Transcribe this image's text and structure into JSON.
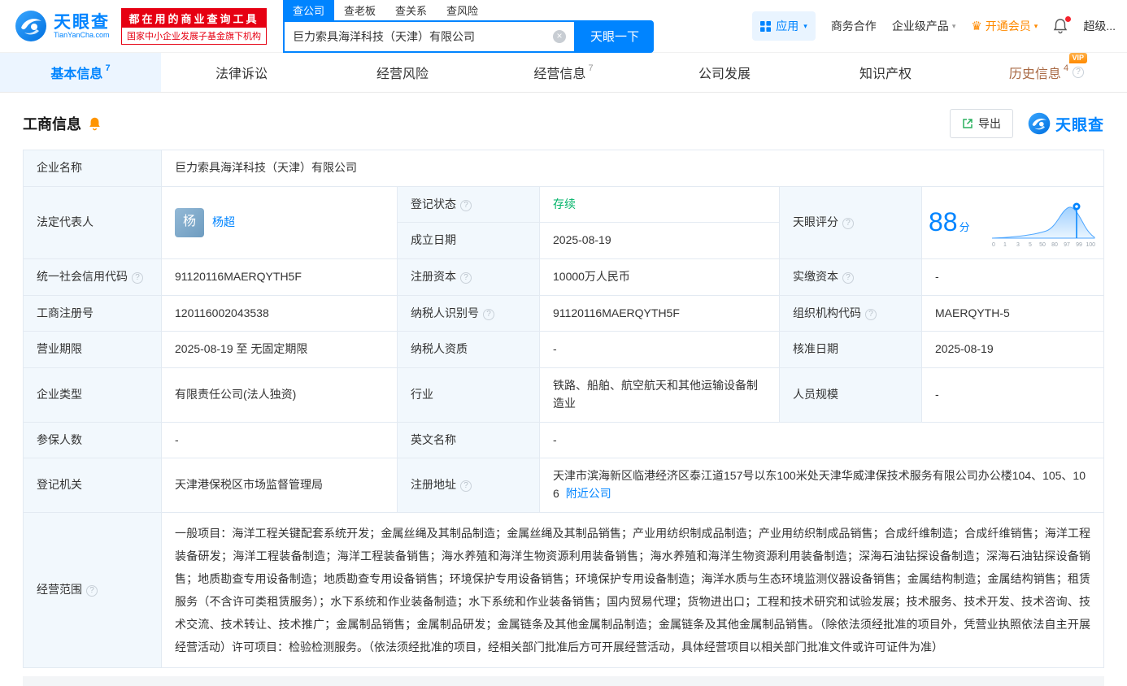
{
  "colors": {
    "brand": "#0084ff",
    "red": "#e60012",
    "green": "#00b368",
    "orange": "#ff8a00"
  },
  "header": {
    "logo": {
      "title": "天眼查",
      "subtitle": "TianYanCha.com"
    },
    "promo": {
      "line1": "都在用的商业查询工具",
      "line2": "国家中小企业发展子基金旗下机构"
    },
    "search_tabs": [
      {
        "label": "查公司"
      },
      {
        "label": "查老板"
      },
      {
        "label": "查关系"
      },
      {
        "label": "查风险"
      }
    ],
    "search": {
      "value": "巨力索具海洋科技（天津）有限公司",
      "button": "天眼一下"
    },
    "menu": {
      "apps": "应用",
      "cooperation": "商务合作",
      "enterprise": "企业级产品",
      "vip": "开通会员",
      "super": "超级..."
    }
  },
  "nav_tabs": [
    {
      "label": "基本信息",
      "count": "7"
    },
    {
      "label": "法律诉讼",
      "count": ""
    },
    {
      "label": "经营风险",
      "count": ""
    },
    {
      "label": "经营信息",
      "count": "7"
    },
    {
      "label": "公司发展",
      "count": ""
    },
    {
      "label": "知识产权",
      "count": ""
    },
    {
      "label": "历史信息",
      "count": "4",
      "badge": "VIP"
    }
  ],
  "section": {
    "title": "工商信息",
    "export_label": "导出",
    "watermark": "天眼查"
  },
  "fields": {
    "company_name": {
      "label": "企业名称",
      "value": "巨力索具海洋科技（天津）有限公司"
    },
    "legal_rep": {
      "label": "法定代表人",
      "avatar": "杨",
      "value": "杨超"
    },
    "reg_status": {
      "label": "登记状态",
      "value": "存续"
    },
    "est_date": {
      "label": "成立日期",
      "value": "2025-08-19"
    },
    "score": {
      "label": "天眼评分",
      "value": "88",
      "unit": "分",
      "axis": [
        "0",
        "1",
        "3",
        "5",
        "50",
        "80",
        "97",
        "99",
        "100"
      ]
    },
    "credit_code": {
      "label": "统一社会信用代码",
      "value": "91120116MAERQYTH5F"
    },
    "reg_capital": {
      "label": "注册资本",
      "value": "10000万人民币"
    },
    "paid_capital": {
      "label": "实缴资本",
      "value": "-"
    },
    "reg_number": {
      "label": "工商注册号",
      "value": "120116002043538"
    },
    "taxpayer_id": {
      "label": "纳税人识别号",
      "value": "91120116MAERQYTH5F"
    },
    "org_code": {
      "label": "组织机构代码",
      "value": "MAERQYTH-5"
    },
    "business_term": {
      "label": "营业期限",
      "value": "2025-08-19 至 无固定期限"
    },
    "taxpayer_quality": {
      "label": "纳税人资质",
      "value": "-"
    },
    "approval_date": {
      "label": "核准日期",
      "value": "2025-08-19"
    },
    "company_type": {
      "label": "企业类型",
      "value": "有限责任公司(法人独资)"
    },
    "industry": {
      "label": "行业",
      "value": "铁路、船舶、航空航天和其他运输设备制造业"
    },
    "staff_size": {
      "label": "人员规模",
      "value": "-"
    },
    "insured_count": {
      "label": "参保人数",
      "value": "-"
    },
    "english_name": {
      "label": "英文名称",
      "value": "-"
    },
    "reg_authority": {
      "label": "登记机关",
      "value": "天津港保税区市场监督管理局"
    },
    "reg_address": {
      "label": "注册地址",
      "value": "天津市滨海新区临港经济区泰江道157号以东100米处天津华威津保技术服务有限公司办公楼104、105、106",
      "link": "附近公司"
    },
    "business_scope": {
      "label": "经营范围",
      "value": "一般项目：海洋工程关键配套系统开发；金属丝绳及其制品制造；金属丝绳及其制品销售；产业用纺织制成品制造；产业用纺织制成品销售；合成纤维制造；合成纤维销售；海洋工程装备研发；海洋工程装备制造；海洋工程装备销售；海水养殖和海洋生物资源利用装备销售；海水养殖和海洋生物资源利用装备制造；深海石油钻探设备制造；深海石油钻探设备销售；地质勘查专用设备制造；地质勘查专用设备销售；环境保护专用设备销售；环境保护专用设备制造；海洋水质与生态环境监测仪器设备销售；金属结构制造；金属结构销售；租赁服务（不含许可类租赁服务）；水下系统和作业装备制造；水下系统和作业装备销售；国内贸易代理；货物进出口；工程和技术研究和试验发展；技术服务、技术开发、技术咨询、技术交流、技术转让、技术推广；金属制品销售；金属制品研发；金属链条及其他金属制品制造；金属链条及其他金属制品销售。（除依法须经批准的项目外，凭营业执照依法自主开展经营活动）许可项目：检验检测服务。（依法须经批准的项目，经相关部门批准后方可开展经营活动，具体经营项目以相关部门批准文件或许可证件为准）"
    }
  }
}
